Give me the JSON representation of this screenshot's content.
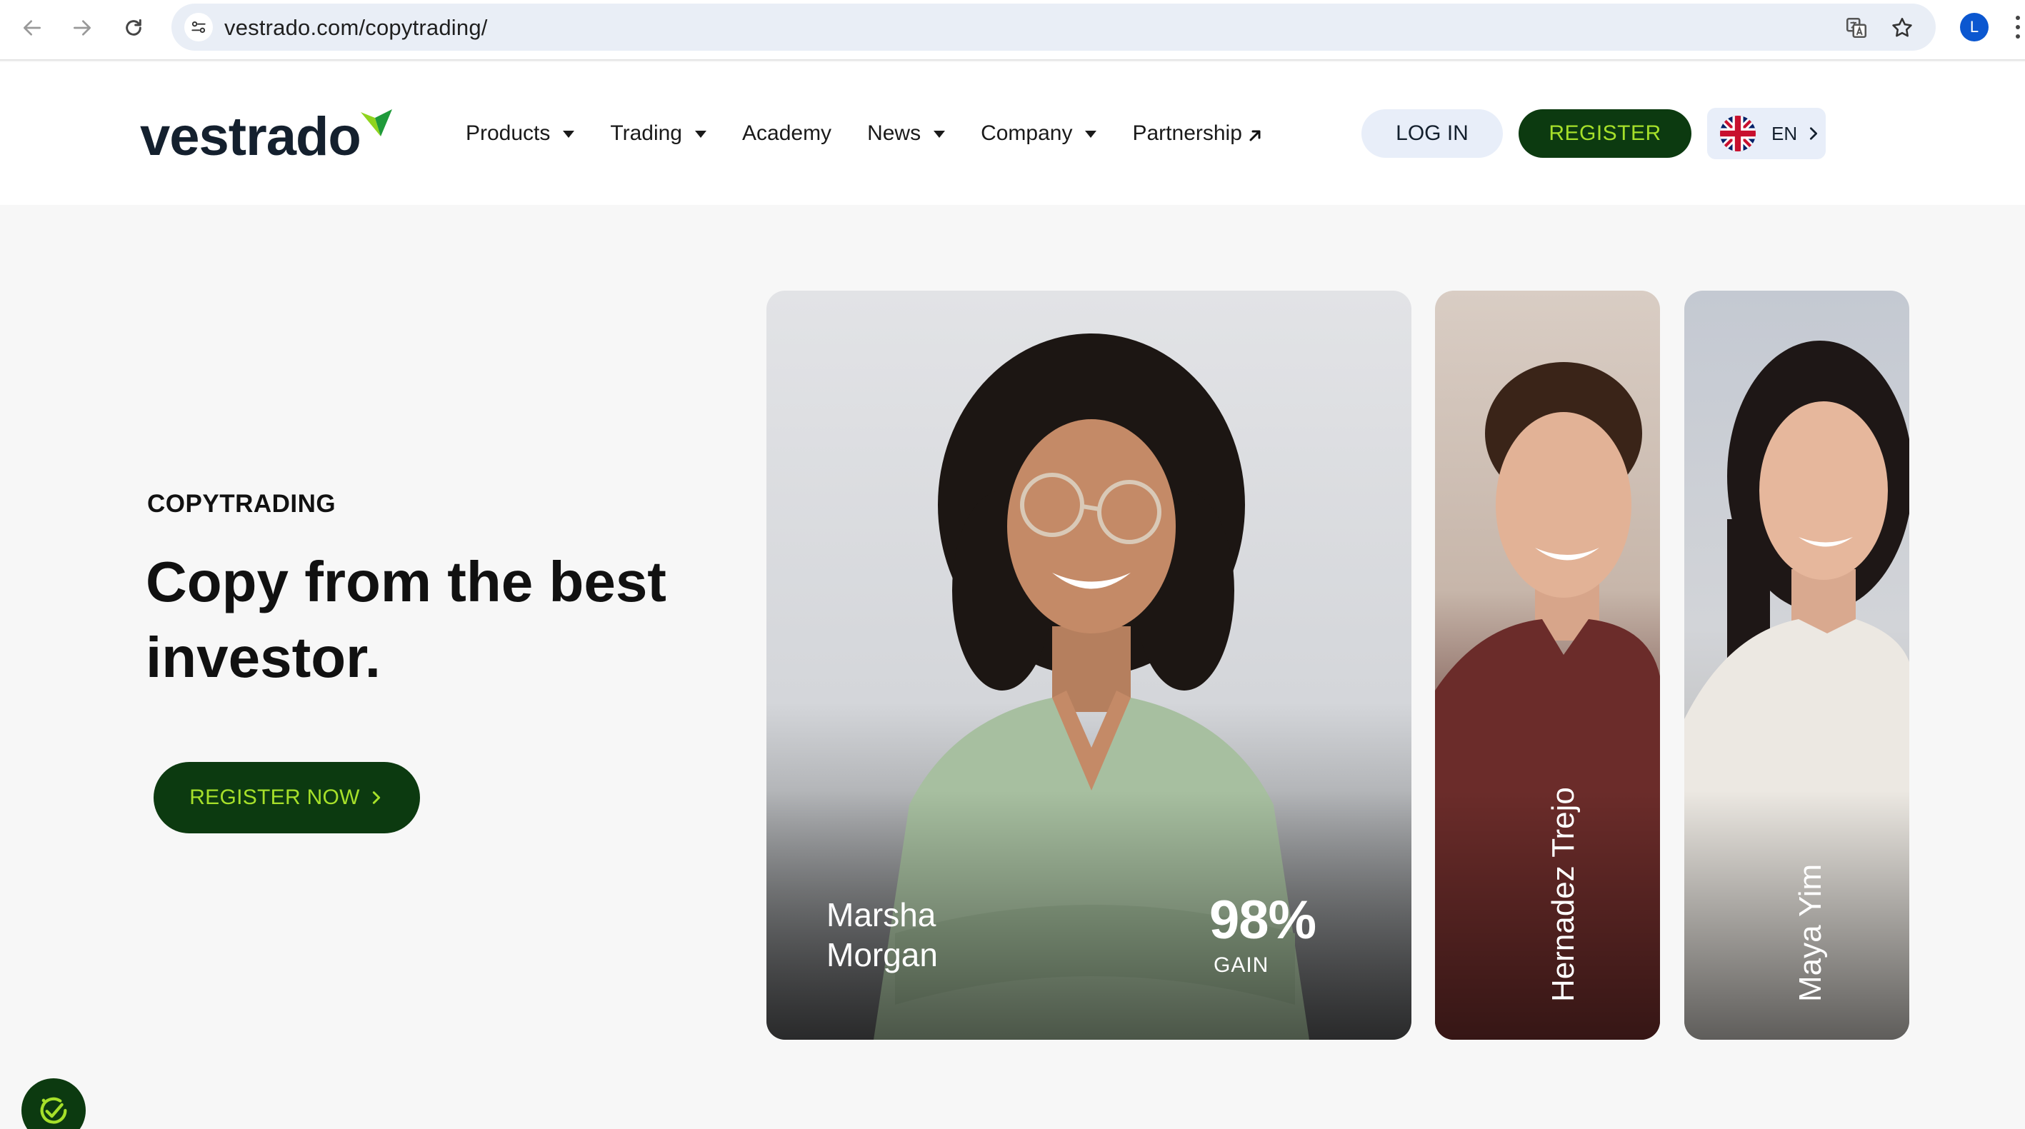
{
  "browser": {
    "url": "vestrado.com/copytrading/",
    "profile_initial": "L"
  },
  "header": {
    "logo_text": "vestrado",
    "menu": [
      {
        "label": "Products",
        "has_dropdown": true
      },
      {
        "label": "Trading",
        "has_dropdown": true
      },
      {
        "label": "Academy",
        "has_dropdown": false
      },
      {
        "label": "News",
        "has_dropdown": true
      },
      {
        "label": "Company",
        "has_dropdown": true
      },
      {
        "label": "Partnership",
        "external": true
      }
    ],
    "login_label": "LOG IN",
    "register_label": "REGISTER",
    "language": "EN"
  },
  "hero": {
    "eyebrow": "COPYTRADING",
    "headline_line1": "Copy from the best",
    "headline_line2": "investor.",
    "cta_label": "REGISTER NOW"
  },
  "traders": [
    {
      "first_name": "Marsha",
      "last_name": "Morgan",
      "gain_value": "98%",
      "gain_label": "GAIN"
    },
    {
      "name": "Hernadez Trejo"
    },
    {
      "name": "Maya Yim"
    }
  ],
  "colors": {
    "brand_dark": "#0c3a10",
    "brand_lime": "#a6e02a",
    "login_bg": "#e8eef9",
    "page_bg": "#f7f7f7"
  }
}
